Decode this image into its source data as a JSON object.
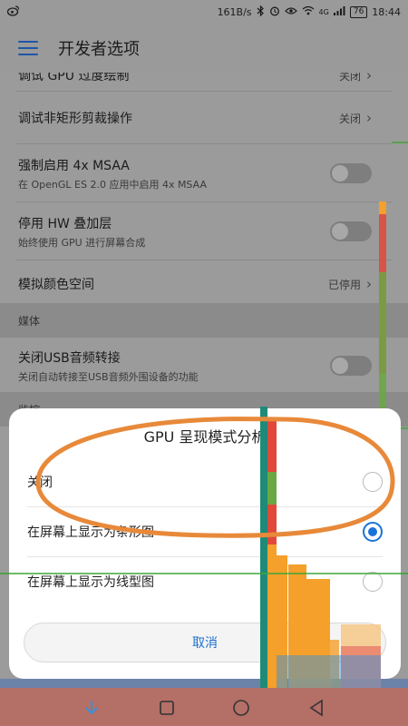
{
  "status_bar": {
    "left_icon": "weibo-icon",
    "speed": "161B/s",
    "network": "4G",
    "battery": "76",
    "time": "18:44"
  },
  "toolbar": {
    "title": "开发者选项"
  },
  "settings": [
    {
      "title": "调试 GPU 过度绘制",
      "value": "关闭"
    },
    {
      "title": "调试非矩形剪裁操作",
      "value": "关闭"
    },
    {
      "title": "强制启用 4x MSAA",
      "subtitle": "在 OpenGL ES 2.0 应用中启用 4x MSAA",
      "toggle": false
    },
    {
      "title": "停用 HW 叠加层",
      "subtitle": "始终使用 GPU 进行屏幕合成",
      "toggle": false
    },
    {
      "title": "模拟颜色空间",
      "value": "已停用"
    }
  ],
  "section_media": "媒体",
  "usb_audio": {
    "title": "关闭USB音频转接",
    "subtitle": "关闭自动转接至USB音频外围设备的功能",
    "toggle": false
  },
  "section_monitor": "监控",
  "dialog": {
    "title": "GPU 呈现模式分析",
    "options": [
      {
        "label": "关闭",
        "selected": false
      },
      {
        "label": "在屏幕上显示为条形图",
        "selected": true
      },
      {
        "label": "在屏幕上显示为线型图",
        "selected": false
      }
    ],
    "cancel_label": "取消"
  },
  "colors": {
    "accent": "#1a73d8",
    "annotation": "#e8893a",
    "bar_orange": "#f4a02a",
    "bar_red": "#e0483a",
    "bar_teal": "#1f8a78",
    "bar_green": "#6aa843",
    "bar_blue": "#3b8fd6"
  }
}
